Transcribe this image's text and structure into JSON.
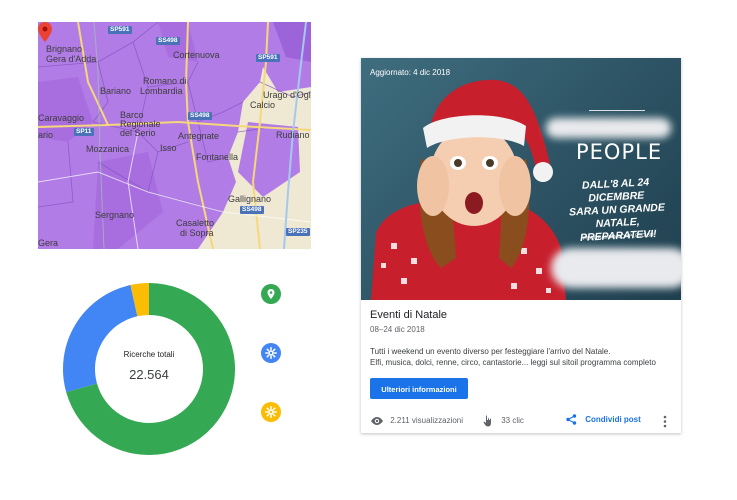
{
  "map": {
    "labels": {
      "brignano": "Brignano",
      "gera_dadda": "Gera d'Adda",
      "romano": "Romano di",
      "lombardia": "Lombardia",
      "bariano": "Bariano",
      "cortenuova": "Cortenuova",
      "urago": "Urago d'Oglio",
      "calcio": "Calcio",
      "caravaggio": "Caravaggio",
      "barco": "Barco",
      "regionale": "Regionale",
      "del_serio": "del Serio",
      "rio": "ario",
      "antegnate": "Antegnate",
      "rudiano": "Rudiano",
      "isso": "Isso",
      "mozzanica": "Mozzanica",
      "fontanella": "Fontanella",
      "gallignano": "Gallignano",
      "sergnano": "Sergnano",
      "casaletto": "Casaletto",
      "di_sopra": "di Sopra",
      "gera": "Gera"
    },
    "shields": [
      "SP591",
      "SS498",
      "SP591",
      "SS498",
      "SP11",
      "SS498",
      "SP235"
    ]
  },
  "searches": {
    "title": "Ricerche totali",
    "value": "22.564",
    "segments": [
      {
        "name": "maps",
        "fraction": 0.7066,
        "color": "#34a853"
      },
      {
        "name": "search",
        "fraction": 0.2588,
        "color": "#4285f4"
      },
      {
        "name": "other",
        "fraction": 0.0346,
        "color": "#fbbc04"
      }
    ],
    "legend": [
      {
        "icon": "map-pin-icon",
        "color": "#34a853"
      },
      {
        "icon": "search-settings-icon",
        "color": "#4285f4"
      },
      {
        "icon": "settings-icon",
        "color": "#fbbc04"
      }
    ]
  },
  "post": {
    "updated": "Aggiornato: 4 dic 2018",
    "image_text": {
      "people": "PEOPLE",
      "promo_line1": "DALL'8 AL 24 DICEMBRE",
      "promo_line2": "SARA UN GRANDE NATALE,",
      "promo_line3": "PREPARATEVI!",
      "promo_small": "PROGRAMMA COMPLETO SU"
    },
    "title": "Eventi di Natale",
    "date": "08–24 dic 2018",
    "desc_line1": "Tutti i weekend un evento diverso per festeggiare l'arrivo del Natale.",
    "desc_line2": "Elfi, musica, dolci, renne, circo, cantastorie... leggi sul sitoil programma completo",
    "cta": "Ulteriori informazioni",
    "views": "2.211 visualizzazioni",
    "clicks": "33 clic",
    "share": "Condividi post"
  }
}
